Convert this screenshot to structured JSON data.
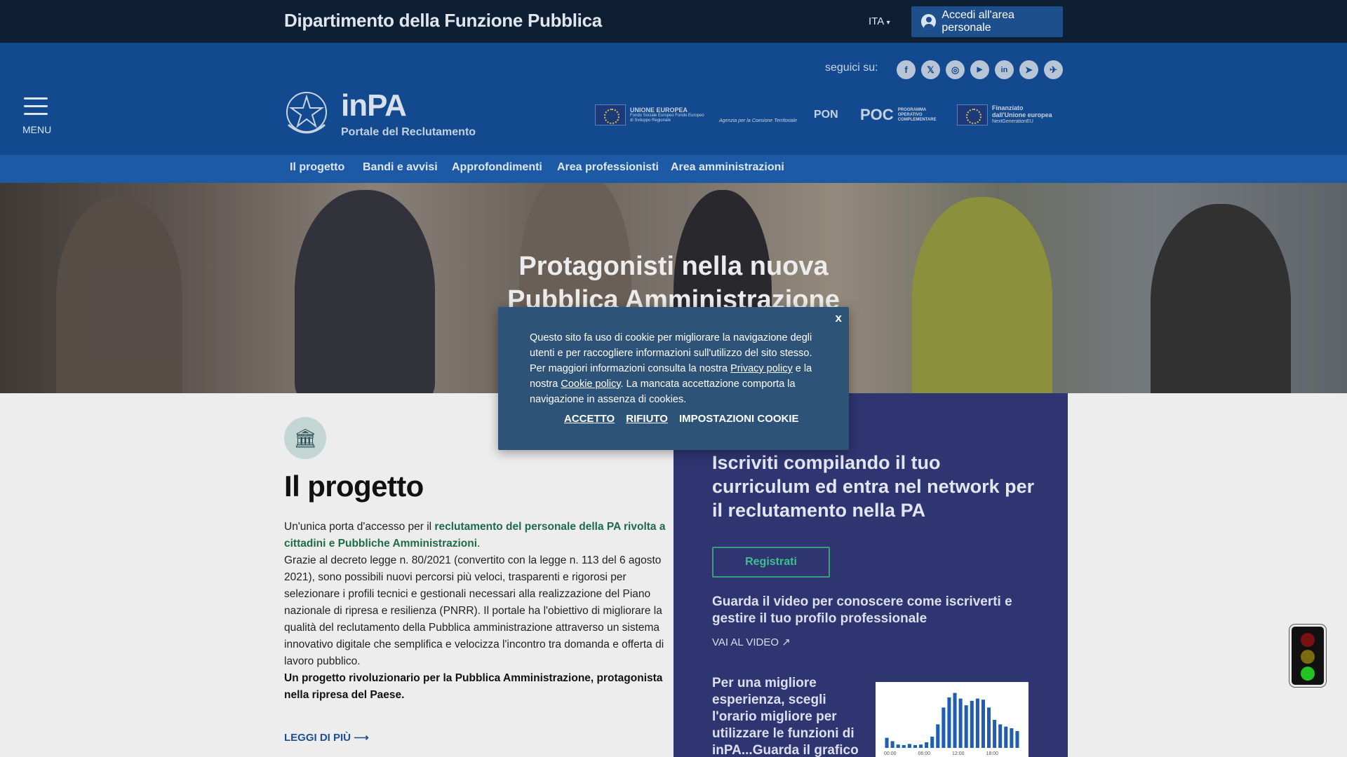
{
  "topbar": {
    "department": "Dipartimento della Funzione Pubblica",
    "language": "ITA",
    "login_label": "Accedi all'area personale"
  },
  "header": {
    "menu_label": "MENU",
    "follow_label": "seguici su:",
    "social": [
      {
        "name": "facebook-icon",
        "glyph": "f"
      },
      {
        "name": "x-icon",
        "glyph": "𝕏"
      },
      {
        "name": "instagram-icon",
        "glyph": "◎"
      },
      {
        "name": "youtube-icon",
        "glyph": "▶"
      },
      {
        "name": "linkedin-icon",
        "glyph": "in"
      },
      {
        "name": "telegram-icon",
        "glyph": "➤"
      },
      {
        "name": "airplane-icon",
        "glyph": "✈"
      }
    ],
    "brand": "inPA",
    "brand_sub": "Portale del Reclutamento",
    "logos": {
      "eu_1": "UNIONE EUROPEA",
      "eu_1_sub": "Fondo Sociale Europeo Fondo Europeo di Sviluppo Regionale",
      "agency": "Agenzia per la Coesione Territoriale",
      "pon": "PON",
      "poc": "POC",
      "poc_sub": "PROGRAMMA OPERATIVO COMPLEMENTARE",
      "eu_2": "Finanziato dall'Unione europea",
      "eu_2_sub": "NextGenerationEU"
    }
  },
  "nav": [
    "Il progetto",
    "Bandi e avvisi",
    "Approfondimenti",
    "Area professionisti",
    "Area amministrazioni"
  ],
  "hero": {
    "title": "Protagonisti nella nuova Pubblica Amministrazione"
  },
  "project": {
    "icon": "🏛",
    "title": "Il progetto",
    "intro": "Un'unica porta d'accesso per il ",
    "intro_highlight": "reclutamento del personale della PA rivolta a cittadini e Pubbliche Amministrazioni",
    "intro_end": ".",
    "body": "Grazie al decreto legge n. 80/2021 (convertito con la legge n. 113 del 6 agosto 2021), sono possibili nuovi percorsi più veloci, trasparenti e rigorosi per selezionare i profili tecnici e gestionali necessari alla realizzazione del Piano nazionale di ripresa e resilienza (PNRR). Il portale ha l'obiettivo di migliorare la qualità del reclutamento della Pubblica amministrazione attraverso un sistema innovativo digitale che semplifica e velocizza l'incontro tra domanda e offerta di lavoro pubblico.",
    "closing": "Un progetto rivoluzionario per la Pubblica Amministrazione, protagonista nella ripresa del Paese.",
    "read_more": "LEGGI DI PIÙ"
  },
  "panel": {
    "title": "Iscriviti compilando il tuo curriculum ed entra nel network per il reclutamento nella PA",
    "register": "Registrati",
    "video_text": "Guarda il video per conoscere come iscriverti e gestire il tuo profilo professionale",
    "video_link": "VAI AL VIDEO",
    "experience": "Per una migliore esperienza, scegli l'orario migliore per utilizzare le funzioni di inPA...Guarda il grafico"
  },
  "chart_data": {
    "type": "bar",
    "x_ticks": [
      "00:00",
      "06:00",
      "12:00",
      "18:00"
    ],
    "values": [
      0.18,
      0.12,
      0.06,
      0.05,
      0.07,
      0.05,
      0.06,
      0.1,
      0.2,
      0.42,
      0.72,
      0.9,
      0.98,
      0.88,
      0.76,
      0.84,
      0.88,
      0.86,
      0.72,
      0.5,
      0.42,
      0.38,
      0.35,
      0.3
    ],
    "color": "#1f5fb0"
  },
  "cookie": {
    "close": "x",
    "text_1": "Questo sito fa uso di cookie per migliorare la navigazione degli utenti e per raccogliere informazioni sull'utilizzo del sito stesso. Per maggiori informazioni consulta la nostra ",
    "privacy_link": "Privacy policy",
    "text_2": " e la nostra ",
    "cookie_link": "Cookie policy",
    "text_3": ". La mancata accettazione comporta la navigazione in assenza di cookies.",
    "accept": "ACCETTO",
    "reject": "RIFIUTO",
    "settings": "IMPOSTAZIONI COOKIE"
  },
  "colors": {
    "topbar": "#0e1e33",
    "header": "#134a8f",
    "nav": "#1c5aa6",
    "panel": "#2e3570",
    "cookie": "#2e5379",
    "accent_green": "#1e6b4a"
  }
}
